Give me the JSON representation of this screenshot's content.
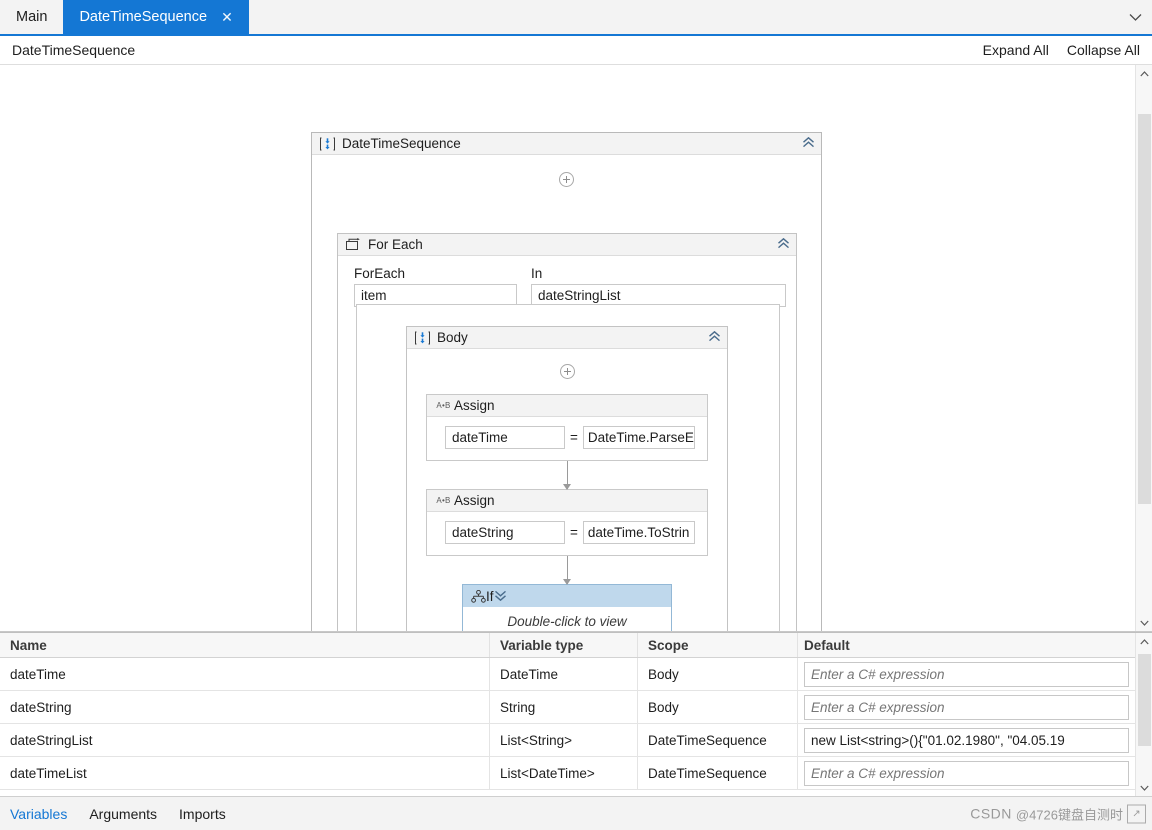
{
  "tabs": {
    "items": [
      {
        "label": "Main",
        "active": false,
        "closable": false
      },
      {
        "label": "DateTimeSequence",
        "active": true,
        "closable": true
      }
    ],
    "close_glyph": "✕",
    "overflow_glyph": "⌄"
  },
  "cmdbar": {
    "breadcrumb": "DateTimeSequence",
    "expand_all": "Expand All",
    "collapse_all": "Collapse All"
  },
  "designer": {
    "root": {
      "title": "DateTimeSequence",
      "icon": "sequence-icon",
      "collapse_glyph": "«"
    },
    "foreach": {
      "title": "For Each",
      "icon": "foreach-icon",
      "collapse_glyph": "«",
      "foreach_label": "ForEach",
      "foreach_value": "item",
      "in_label": "In",
      "in_value": "dateStringList"
    },
    "body": {
      "title": "Body",
      "icon": "sequence-icon",
      "collapse_glyph": "«"
    },
    "assign1": {
      "title": "Assign",
      "icon": "assign-icon",
      "icon_text": "A•B",
      "to": "dateTime",
      "operator": "=",
      "value": "DateTime.ParseEx"
    },
    "assign2": {
      "title": "Assign",
      "icon": "assign-icon",
      "icon_text": "A•B",
      "to": "dateString",
      "operator": "=",
      "value": "dateTime.ToStrin"
    },
    "if": {
      "title": "If",
      "icon": "if-icon",
      "expand_glyph": "»",
      "collapsed_text": "Double-click to view",
      "selected_color": "#bfd8ec"
    }
  },
  "variables_grid": {
    "columns": [
      "Name",
      "Variable type",
      "Scope",
      "Default"
    ],
    "rows": [
      {
        "name": "dateTime",
        "type": "DateTime",
        "scope": "Body",
        "default": "",
        "default_placeholder": "Enter a C# expression"
      },
      {
        "name": "dateString",
        "type": "String",
        "scope": "Body",
        "default": "",
        "default_placeholder": "Enter a C# expression"
      },
      {
        "name": "dateStringList",
        "type": "List<String>",
        "scope": "DateTimeSequence",
        "default": "new List<string>(){\"01.02.1980\", \"04.05.19",
        "default_placeholder": "Enter a C# expression"
      },
      {
        "name": "dateTimeList",
        "type": "List<DateTime>",
        "scope": "DateTimeSequence",
        "default": "",
        "default_placeholder": "Enter a C# expression"
      }
    ]
  },
  "footer": {
    "tabs": [
      {
        "label": "Variables",
        "active": true
      },
      {
        "label": "Arguments",
        "active": false
      },
      {
        "label": "Imports",
        "active": false
      }
    ]
  },
  "watermark": {
    "logo": "CSDN",
    "text": "@4726键盘自测时",
    "badge": "↗"
  },
  "scrollbars": {
    "up_glyph": "∧",
    "down_glyph": "∨"
  },
  "colors": {
    "accent": "#1477d4",
    "selection": "#bfd8ec",
    "header_bg": "#f3f3f3",
    "border": "#c3c3c3"
  }
}
